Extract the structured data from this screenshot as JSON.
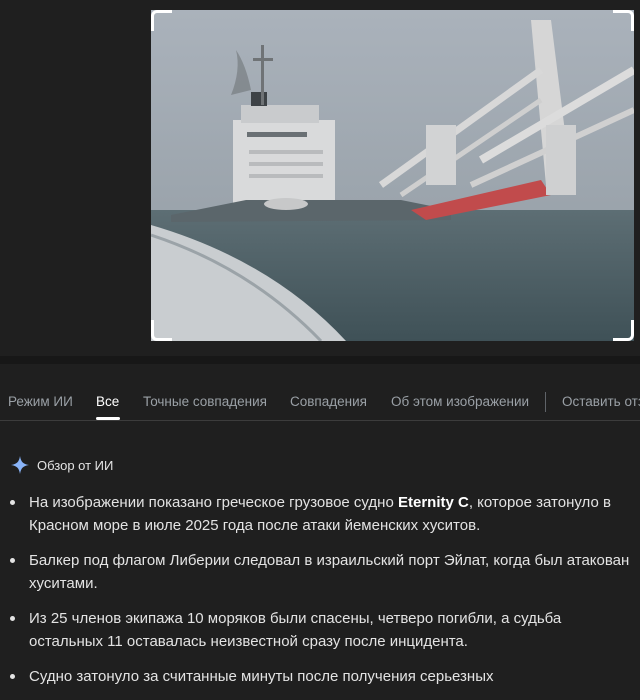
{
  "image_viewer": {
    "image_description_icon": "ship-photo"
  },
  "tabs": [
    {
      "label": "Режим ИИ"
    },
    {
      "label": "Все"
    },
    {
      "label": "Точные совпадения"
    },
    {
      "label": "Совпадения"
    },
    {
      "label": "Об этом изображении"
    },
    {
      "label": "Оставить отзыв"
    }
  ],
  "ai_overview": {
    "title": "Обзор от ИИ",
    "icon": "sparkle-icon",
    "bullets": [
      {
        "before": "На изображении показано греческое грузовое судно ",
        "bold": "Eternity C",
        "after": ", которое затонуло в Красном море в июле 2025 года после атаки йеменских хуситов."
      },
      {
        "text": "Балкер под флагом Либерии следовал в израильский порт Эйлат, когда был атакован хуситами."
      },
      {
        "text": "Из 25 членов экипажа 10 моряков были спасены, четверо погибли, а судьба остальных 11 оставалась неизвестной сразу после инцидента."
      },
      {
        "text": "Судно затонуло за считанные минуты после получения серьезных"
      }
    ]
  },
  "colors": {
    "background": "#1f1f1f",
    "text": "#e3e3e3",
    "muted": "#9aa0a6",
    "spark_blue": "#8ab4f8"
  }
}
